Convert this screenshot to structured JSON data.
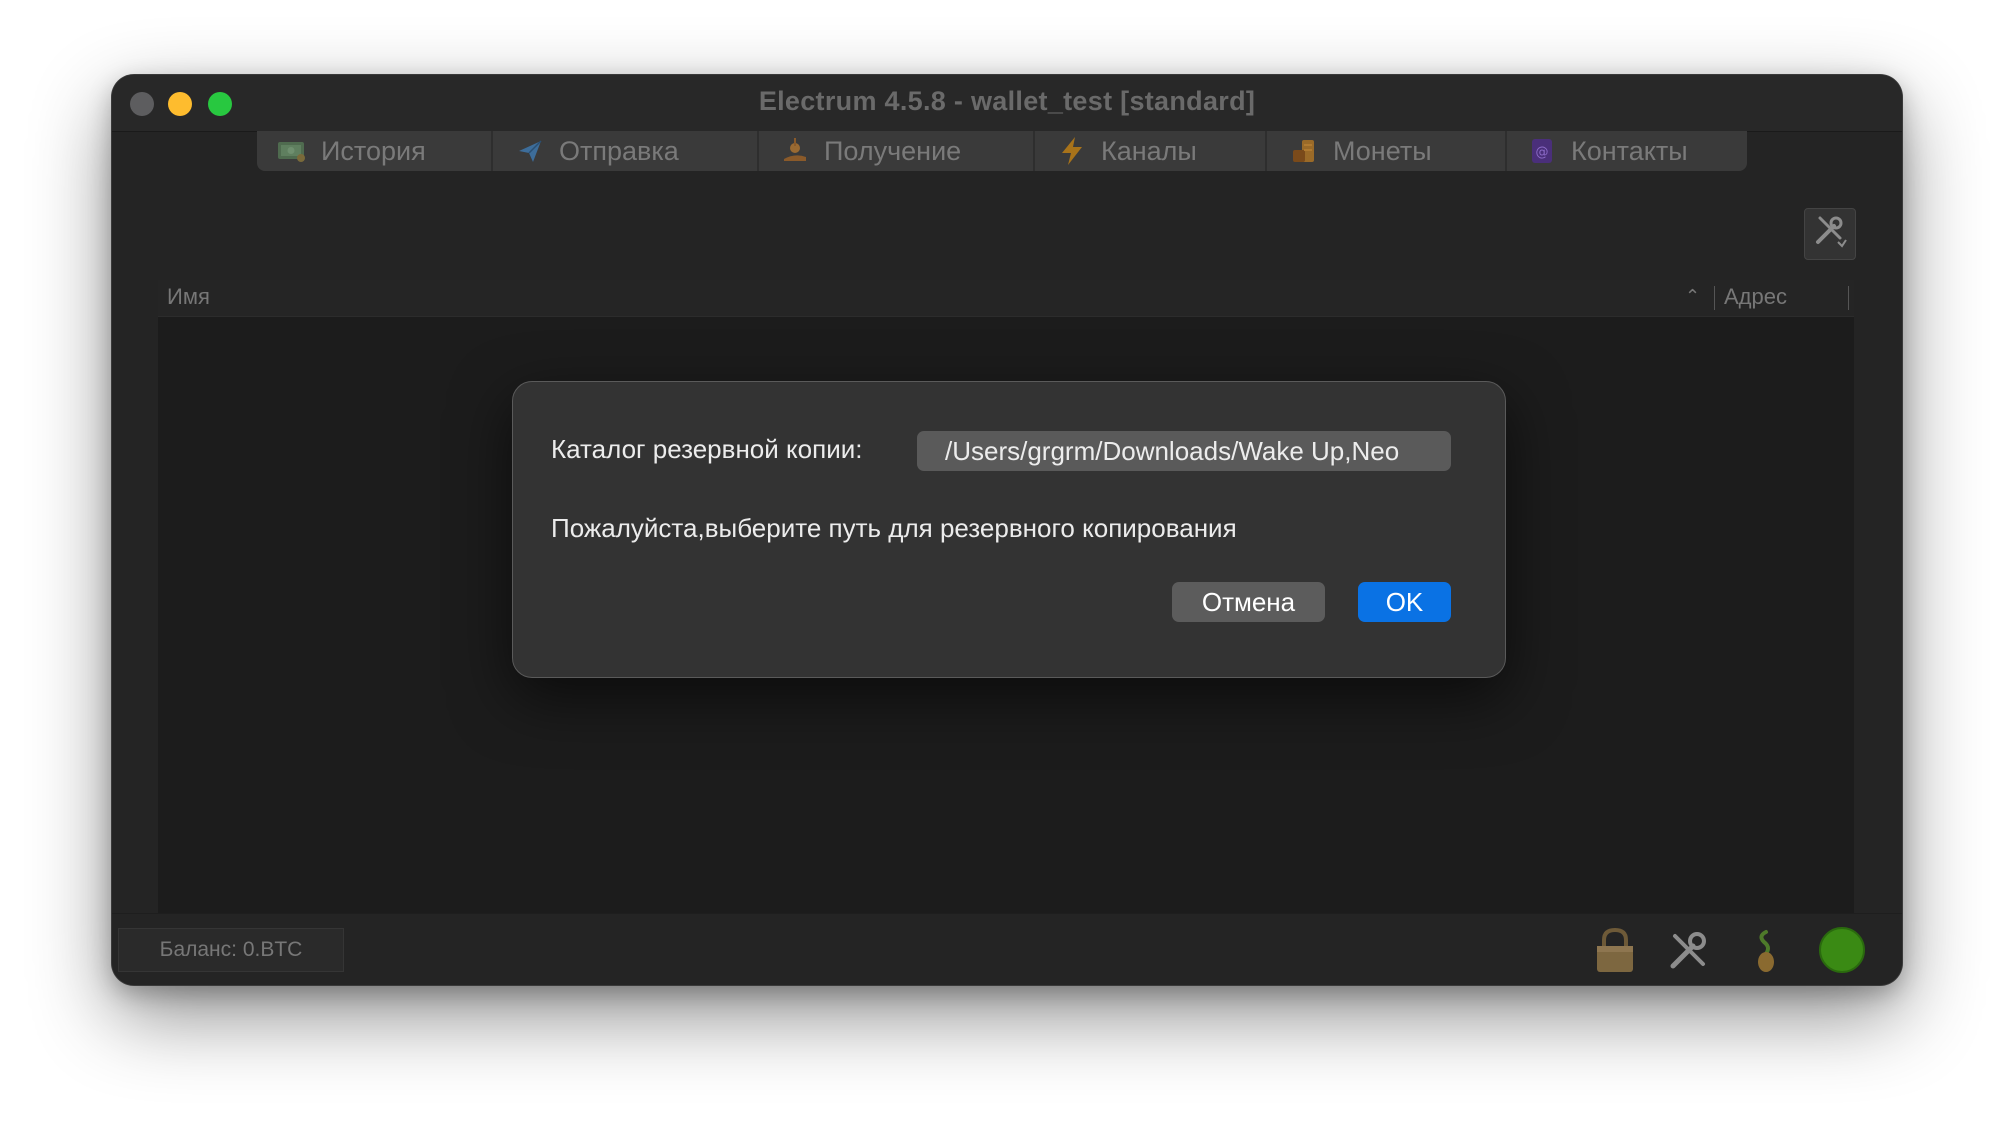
{
  "window": {
    "title": "Electrum 4.5.8  -  wallet_test  [standard]"
  },
  "tabs": [
    {
      "label": "История",
      "icon": "history-icon"
    },
    {
      "label": "Отправка",
      "icon": "send-icon"
    },
    {
      "label": "Получение",
      "icon": "receive-icon"
    },
    {
      "label": "Каналы",
      "icon": "lightning-icon"
    },
    {
      "label": "Монеты",
      "icon": "coins-icon"
    },
    {
      "label": "Контакты",
      "icon": "contacts-icon"
    }
  ],
  "table": {
    "columns": [
      "Имя",
      "Адрес"
    ],
    "sort_indicator": "⌃"
  },
  "statusbar": {
    "balance": "Баланс: 0.BTC",
    "icons": [
      "lock-icon",
      "tools-icon",
      "seed-icon",
      "network-status-icon"
    ]
  },
  "dialog": {
    "label": "Каталог резервной копии:",
    "path_value": "/Users/grgrm/Downloads/Wake Up,Neo",
    "message": "Пожалуйста,выберите путь для резервного копирования",
    "cancel_label": "Отмена",
    "ok_label": "OK"
  },
  "colors": {
    "accent": "#0a72e4",
    "window_bg": "#242424",
    "dialog_bg": "#333333",
    "network_status": "#3a8a14"
  }
}
